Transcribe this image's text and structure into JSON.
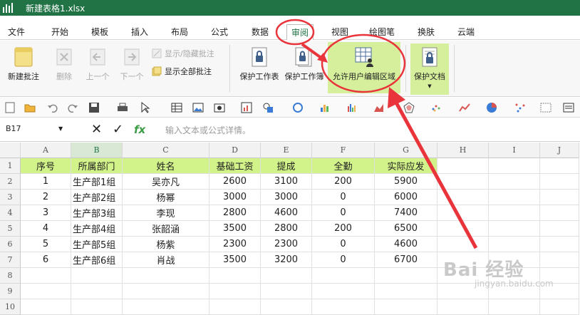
{
  "window": {
    "title": "新建表格1.xlsx"
  },
  "menu": [
    "文件",
    "开始",
    "模板",
    "插入",
    "布局",
    "公式",
    "数据",
    "审阅",
    "视图",
    "绘图笔",
    "换肤",
    "云端"
  ],
  "ribbon": {
    "new_comment": "新建批注",
    "delete": "删除",
    "prev": "上一个",
    "next": "下一个",
    "show_hide_comment": "显示/隐藏批注",
    "show_all_comments": "显示全部批注",
    "protect_sheet": "保护工作表",
    "protect_workbook": "保护工作簿",
    "allow_edit_ranges": "允许用户编辑区域",
    "protect_document": "保护文档"
  },
  "formula": {
    "name_box": "B17",
    "placeholder": "输入文本或公式详情。",
    "fx": "fx"
  },
  "grid": {
    "columns": [
      "A",
      "B",
      "C",
      "D",
      "E",
      "F",
      "G",
      "H",
      "I",
      "J"
    ],
    "rows": [
      "1",
      "2",
      "3",
      "4",
      "5",
      "6",
      "7",
      "8",
      "9",
      "10"
    ],
    "header": [
      "序号",
      "所属部门",
      "姓名",
      "基础工资",
      "提成",
      "全勤",
      "实际应发"
    ],
    "data": [
      [
        "1",
        "生产部1组",
        "吴亦凡",
        "2600",
        "3100",
        "200",
        "5900"
      ],
      [
        "2",
        "生产部2组",
        "杨幂",
        "3000",
        "3000",
        "0",
        "6000"
      ],
      [
        "3",
        "生产部3组",
        "李现",
        "2800",
        "4600",
        "0",
        "7400"
      ],
      [
        "4",
        "生产部4组",
        "张韶涵",
        "3500",
        "2800",
        "200",
        "6500"
      ],
      [
        "5",
        "生产部5组",
        "杨紫",
        "2300",
        "2300",
        "0",
        "4600"
      ],
      [
        "6",
        "生产部6组",
        "肖战",
        "3500",
        "3200",
        "0",
        "6700"
      ]
    ]
  },
  "watermark": {
    "main": "Bai 经验",
    "sub": "jingyan.baidu.com"
  },
  "colors": {
    "accent": "#217346",
    "header_fill": "#d2f28a",
    "annotation": "#e8343a"
  }
}
